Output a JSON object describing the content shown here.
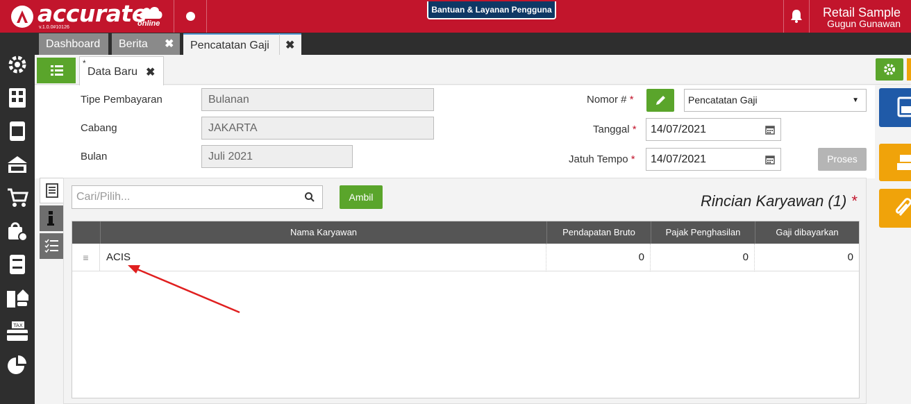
{
  "brand": {
    "logo_text": "accurate",
    "logo_suffix": "online",
    "version": "v.1.0.0#10126",
    "accent": "#c2152c"
  },
  "header": {
    "help_label": "Bantuan & Layanan Pengguna",
    "company": "Retail Sample",
    "user": "Gugun Gunawan"
  },
  "tabs": [
    {
      "label": "Dashboard"
    },
    {
      "label": "Berita"
    },
    {
      "label": "Pencatatan Gaji"
    }
  ],
  "subtab": {
    "star": "*",
    "label": "Data Baru"
  },
  "form": {
    "tipe_pembayaran": {
      "label": "Tipe Pembayaran",
      "value": "Bulanan"
    },
    "cabang": {
      "label": "Cabang",
      "value": "JAKARTA"
    },
    "bulan": {
      "label": "Bulan",
      "value": "Juli 2021"
    },
    "nomor": {
      "label": "Nomor #",
      "req": "*",
      "value": "Pencatatan Gaji"
    },
    "tanggal": {
      "label": "Tanggal",
      "req": "*",
      "value": "14/07/2021"
    },
    "jatuh_tempo": {
      "label": "Jatuh Tempo",
      "req": "*",
      "value": "14/07/2021"
    },
    "proses_label": "Proses"
  },
  "detail": {
    "search_placeholder": "Cari/Pilih...",
    "ambil_label": "Ambil",
    "title": "Rincian Karyawan (1)",
    "req": "*",
    "columns": [
      "Nama Karyawan",
      "Pendapatan Bruto",
      "Pajak Penghasilan",
      "Gaji dibayarkan"
    ],
    "rows": [
      {
        "nama": "ACIS",
        "bruto": "0",
        "pajak": "0",
        "gaji": "0"
      }
    ]
  }
}
